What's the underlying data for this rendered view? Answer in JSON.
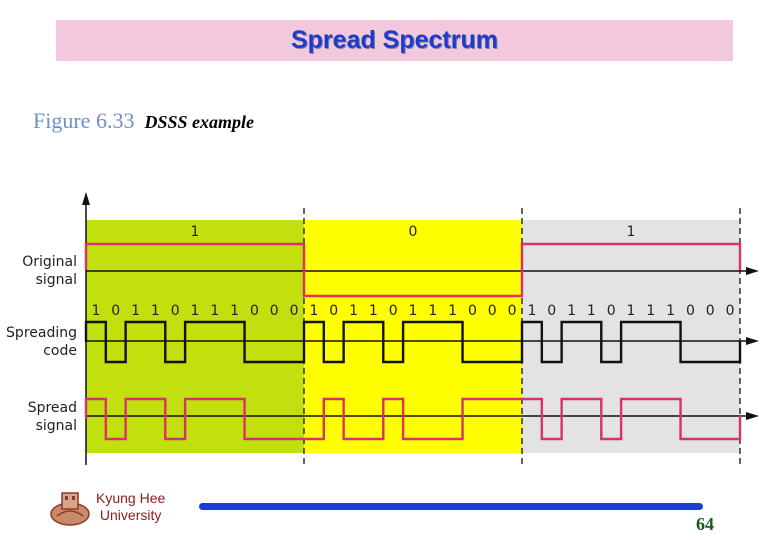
{
  "header": {
    "title": "Spread Spectrum"
  },
  "caption": {
    "figure": "Figure 6.33",
    "subtitle": "DSSS example"
  },
  "diagram": {
    "row_labels": {
      "original": [
        "Original",
        "signal"
      ],
      "spreading": [
        "Spreading",
        "code"
      ],
      "spread": [
        "Spread",
        "signal"
      ]
    },
    "data_bits": [
      "1",
      "0",
      "1"
    ],
    "spreading_code": [
      "1",
      "0",
      "1",
      "1",
      "0",
      "1",
      "1",
      "1",
      "0",
      "0",
      "0"
    ],
    "region_colors": [
      "#c2e00e",
      "#ffff00",
      "#e3e3e3"
    ],
    "signal_color": "#d9306e",
    "code_color": "#111111"
  },
  "footer": {
    "university_line1": "Kyung Hee",
    "university_line2": "University",
    "page_number": "64"
  }
}
